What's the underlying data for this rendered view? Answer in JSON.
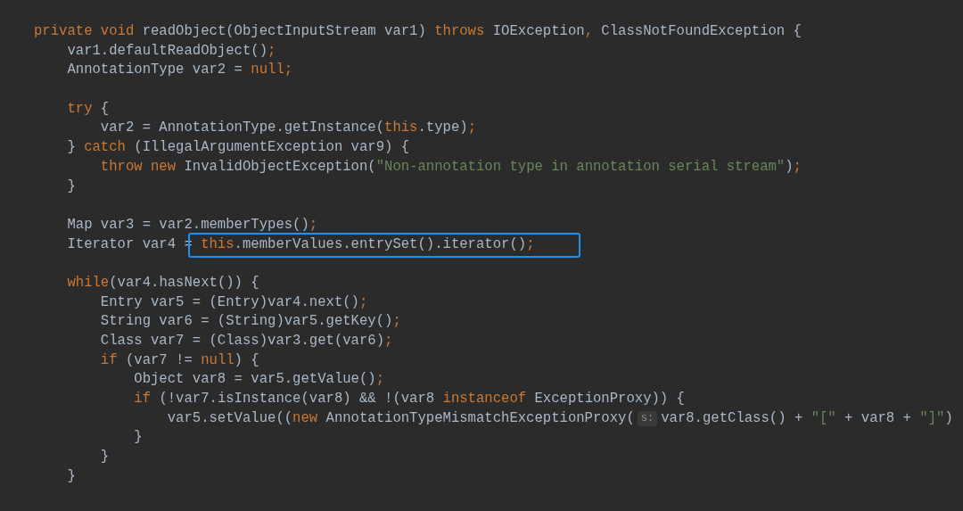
{
  "editor": {
    "lines": [
      {
        "kind": "code",
        "tokens": [
          {
            "kind": "keyword",
            "text": "private void "
          },
          {
            "kind": "plain",
            "text": "readObject(ObjectInputStream var1) "
          },
          {
            "kind": "keyword",
            "text": "throws "
          },
          {
            "kind": "plain",
            "text": "IOException"
          },
          {
            "kind": "punct",
            "text": ","
          },
          {
            "kind": "plain",
            "text": " ClassNotFoundException {"
          }
        ]
      },
      {
        "kind": "code",
        "tokens": [
          {
            "kind": "plain",
            "text": "    var1.defaultReadObject()"
          },
          {
            "kind": "punct",
            "text": ";"
          }
        ]
      },
      {
        "kind": "code",
        "tokens": [
          {
            "kind": "plain",
            "text": "    AnnotationType var2 = "
          },
          {
            "kind": "keyword",
            "text": "null"
          },
          {
            "kind": "punct",
            "text": ";"
          }
        ]
      },
      {
        "kind": "blank"
      },
      {
        "kind": "code",
        "tokens": [
          {
            "kind": "keyword",
            "text": "    try"
          },
          {
            "kind": "plain",
            "text": " {"
          }
        ]
      },
      {
        "kind": "code",
        "tokens": [
          {
            "kind": "plain",
            "text": "        var2 = AnnotationType.getInstance("
          },
          {
            "kind": "keyword",
            "text": "this"
          },
          {
            "kind": "plain",
            "text": ".type)"
          },
          {
            "kind": "punct",
            "text": ";"
          }
        ]
      },
      {
        "kind": "code",
        "tokens": [
          {
            "kind": "plain",
            "text": "    } "
          },
          {
            "kind": "keyword",
            "text": "catch "
          },
          {
            "kind": "plain",
            "text": "(IllegalArgumentException var9) {"
          }
        ]
      },
      {
        "kind": "code",
        "tokens": [
          {
            "kind": "keyword",
            "text": "        throw new "
          },
          {
            "kind": "plain",
            "text": "InvalidObjectException("
          },
          {
            "kind": "string",
            "text": "\"Non-annotation type in annotation serial stream\""
          },
          {
            "kind": "plain",
            "text": ")"
          },
          {
            "kind": "punct",
            "text": ";"
          }
        ]
      },
      {
        "kind": "code",
        "tokens": [
          {
            "kind": "plain",
            "text": "    }"
          }
        ]
      },
      {
        "kind": "blank"
      },
      {
        "kind": "code",
        "tokens": [
          {
            "kind": "plain",
            "text": "    Map var3 = var2.memberTypes()"
          },
          {
            "kind": "punct",
            "text": ";"
          }
        ]
      },
      {
        "kind": "code",
        "tokens": [
          {
            "kind": "plain",
            "text": "    Iterator var4 = "
          }
        ],
        "annotation_box": {
          "tokens": [
            {
              "kind": "keyword",
              "text": "this"
            },
            {
              "kind": "plain",
              "text": ".memberValues.entrySet().iterator()"
            },
            {
              "kind": "punct",
              "text": ";"
            }
          ]
        }
      },
      {
        "kind": "blank"
      },
      {
        "kind": "code",
        "tokens": [
          {
            "kind": "keyword",
            "text": "    while"
          },
          {
            "kind": "plain",
            "text": "(var4.hasNext()) {"
          }
        ]
      },
      {
        "kind": "code",
        "tokens": [
          {
            "kind": "plain",
            "text": "        Entry var5 = (Entry)var4.next()"
          },
          {
            "kind": "punct",
            "text": ";"
          }
        ]
      },
      {
        "kind": "code",
        "tokens": [
          {
            "kind": "plain",
            "text": "        String var6 = (String)var5.getKey()"
          },
          {
            "kind": "punct",
            "text": ";"
          }
        ]
      },
      {
        "kind": "code",
        "tokens": [
          {
            "kind": "plain",
            "text": "        Class var7 = (Class)var3.get(var6)"
          },
          {
            "kind": "punct",
            "text": ";"
          }
        ]
      },
      {
        "kind": "code",
        "tokens": [
          {
            "kind": "keyword",
            "text": "        if "
          },
          {
            "kind": "plain",
            "text": "(var7 != "
          },
          {
            "kind": "keyword",
            "text": "null"
          },
          {
            "kind": "plain",
            "text": ") {"
          }
        ]
      },
      {
        "kind": "code",
        "tokens": [
          {
            "kind": "plain",
            "text": "            Object var8 = var5.getValue()"
          },
          {
            "kind": "punct",
            "text": ";"
          }
        ]
      },
      {
        "kind": "code",
        "tokens": [
          {
            "kind": "keyword",
            "text": "            if "
          },
          {
            "kind": "plain",
            "text": "(!var7.isInstance(var8) && !(var8 "
          },
          {
            "kind": "keyword",
            "text": "instanceof "
          },
          {
            "kind": "plain",
            "text": "ExceptionProxy)) {"
          }
        ]
      },
      {
        "kind": "code",
        "tokens": [
          {
            "kind": "plain",
            "text": "                var5.setValue(("
          },
          {
            "kind": "keyword",
            "text": "new "
          },
          {
            "kind": "plain",
            "text": "AnnotationTypeMismatchExceptionProxy("
          },
          {
            "kind": "hint",
            "text": "s:"
          },
          {
            "kind": "plain",
            "text": "var8.getClass() + "
          },
          {
            "kind": "string",
            "text": "\"[\""
          },
          {
            "kind": "plain",
            "text": " + var8 + "
          },
          {
            "kind": "string",
            "text": "\"]\""
          },
          {
            "kind": "plain",
            "text": ")"
          }
        ]
      },
      {
        "kind": "code",
        "tokens": [
          {
            "kind": "plain",
            "text": "            }"
          }
        ]
      },
      {
        "kind": "code",
        "tokens": [
          {
            "kind": "plain",
            "text": "        }"
          }
        ]
      },
      {
        "kind": "code",
        "tokens": [
          {
            "kind": "plain",
            "text": "    }"
          }
        ]
      }
    ]
  }
}
